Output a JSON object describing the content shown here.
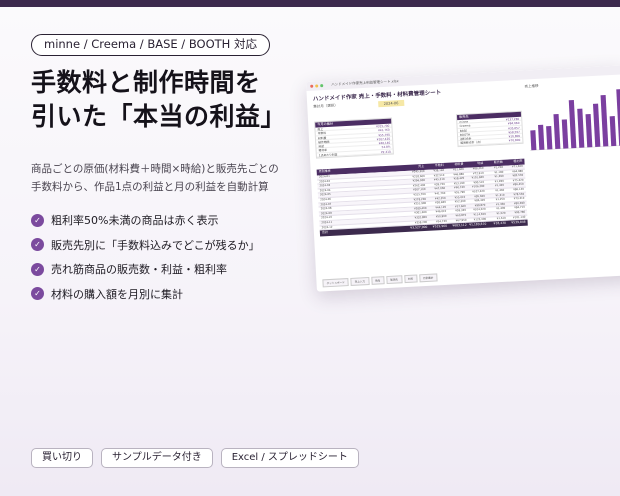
{
  "badge": "minne / Creema / BASE / BOOTH 対応",
  "headline": [
    "手数料と制作時間を",
    "引いた「本当の利益」"
  ],
  "description": [
    "商品ごとの原価(材料費＋時間×時給)と販売先ごとの",
    "手数料から、作品1点の利益と月の利益を自動計算"
  ],
  "features": [
    "粗利率50%未満の商品は赤く表示",
    "販売先別に「手数料込みでどこが残るか」",
    "売れ筋商品の販売数・利益・粗利率",
    "材料の購入額を月別に集計"
  ],
  "chips": [
    "買い切り",
    "サンプルデータ付き",
    "Excel / スプレッドシート"
  ],
  "mockup": {
    "window_title": "ハンドメイド作家売上利益管理シート.xlsx",
    "sheet_title": "ハンドメイド作家 売上・手数料・材料費管理シート",
    "month_label": "集計月（選択）",
    "month_value": "2024-06",
    "chart_title": "売上推移",
    "summary_header": "今月の集計",
    "summary_rows": [
      [
        "売上",
        "¥315,700"
      ],
      [
        "手数料",
        "¥41,760"
      ],
      [
        "材料費",
        "¥55,790"
      ],
      [
        "制作時間",
        "¥107,420"
      ],
      [
        "利益",
        "¥46,140"
      ],
      [
        "粗利率",
        "54.8%"
      ],
      [
        "1点あたり利益",
        "¥2,310"
      ]
    ],
    "side_header": "販売先",
    "side_rows": [
      [
        "minne",
        "¥137,280"
      ],
      [
        "Creema",
        "¥84,060"
      ],
      [
        "BASE",
        "¥35,657"
      ],
      [
        "BOOTH",
        "¥58,597"
      ],
      [
        "送料合計",
        "¥10,800"
      ],
      [
        "販売数合計（点）",
        "¥70,800"
      ]
    ],
    "table_header": [
      "月別推移",
      "売上",
      "手数料",
      "材料費",
      "利益",
      "販売数",
      "粗利率"
    ],
    "table_rows": [
      [
        "2024-01",
        "¥245,300",
        "¥38,140",
        "¥51,600",
        "¥88,260",
        "¥1,240",
        "¥71,360"
      ],
      [
        "2024-02",
        "¥218,600",
        "¥32,510",
        "¥46,880",
        "¥72,910",
        "¥1,180",
        "¥64,980"
      ],
      [
        "2024-03",
        "¥296,900",
        "¥45,210",
        "¥58,420",
        "¥101,840",
        "¥1,390",
        "¥82,530"
      ],
      [
        "2024-04",
        "¥262,400",
        "¥39,720",
        "¥53,190",
        "¥90,510",
        "¥1,280",
        "¥75,320"
      ],
      [
        "2024-05",
        "¥307,100",
        "¥47,060",
        "¥60,740",
        "¥106,290",
        "¥1,420",
        "¥86,450"
      ],
      [
        "2024-06",
        "¥315,700",
        "¥41,760",
        "¥55,790",
        "¥107,420",
        "¥1,460",
        "¥86,140"
      ],
      [
        "2024-07",
        "¥278,200",
        "¥42,350",
        "¥55,010",
        "¥95,600",
        "¥1,310",
        "¥78,560"
      ],
      [
        "2024-08",
        "¥251,900",
        "¥38,480",
        "¥52,300",
        "¥86,420",
        "¥1,250",
        "¥73,310"
      ],
      [
        "2024-09",
        "¥289,400",
        "¥44,120",
        "¥57,660",
        "¥99,870",
        "¥1,360",
        "¥80,690"
      ],
      [
        "2024-10",
        "¥301,600",
        "¥46,010",
        "¥59,330",
        "¥104,220",
        "¥1,400",
        "¥84,710"
      ],
      [
        "2024-11",
        "¥332,800",
        "¥50,900",
        "¥63,870",
        "¥114,650",
        "¥1,520",
        "¥93,780"
      ],
      [
        "2024-12",
        "¥358,200",
        "¥54,730",
        "¥67,950",
        "¥123,300",
        "¥1,610",
        "¥101,140"
      ]
    ],
    "table_footer": [
      "合計",
      "¥3,527,000",
      "¥519,960",
      "¥683,112",
      "¥1,189,870",
      "¥18,430",
      "¥539,846"
    ],
    "tabs": [
      "ダッシュボード",
      "売上入力",
      "商品",
      "販売先",
      "材料",
      "月別集計"
    ],
    "colors": {
      "accent": "#4b2d63",
      "bar": "#7b3fa0"
    }
  },
  "chart_data": {
    "type": "bar",
    "title": "売上推移",
    "values": [
      24,
      30,
      28,
      42,
      35,
      58,
      47,
      40,
      52,
      62,
      36,
      68
    ]
  }
}
